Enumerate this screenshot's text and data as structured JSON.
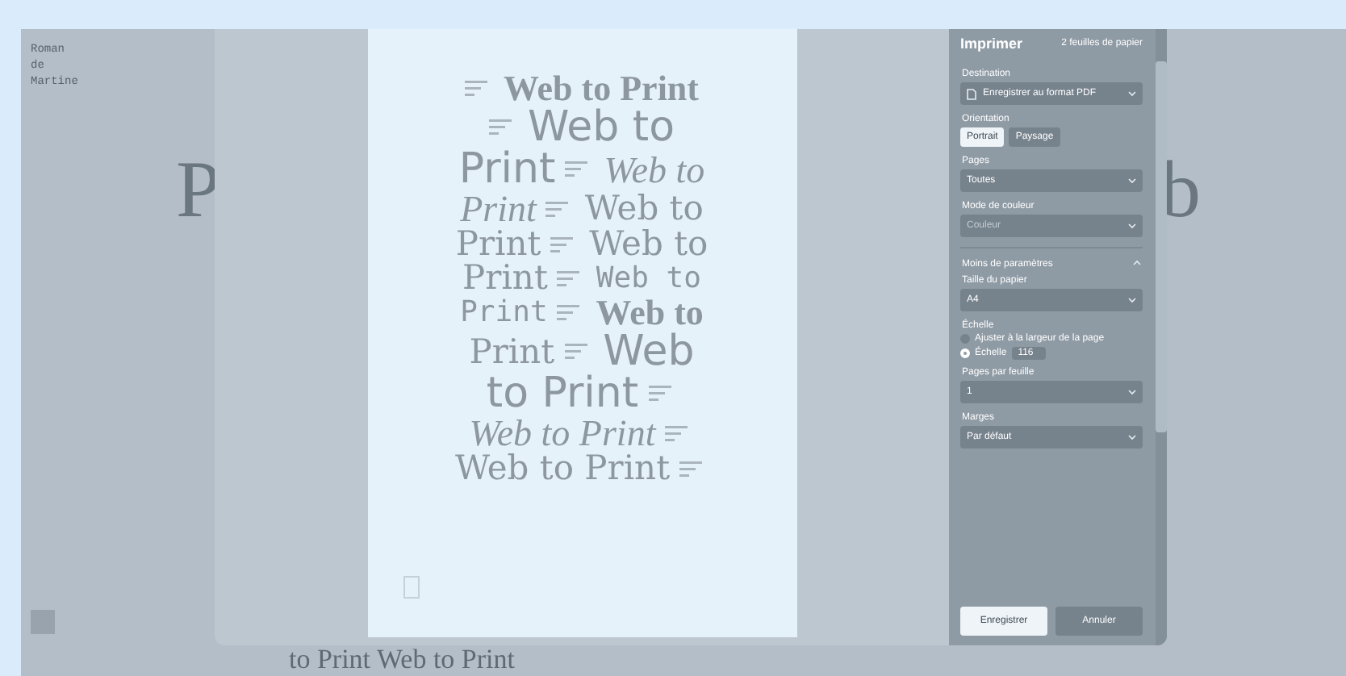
{
  "background_page": {
    "sidebar_text": [
      "Roman",
      "de",
      "Martine"
    ],
    "big_letters": [
      "P",
      "b"
    ],
    "bottom_text": "to Print Web to Print"
  },
  "preview": {
    "lines": [
      [
        {
          "kind": "caption"
        },
        {
          "kind": "serif-bold",
          "text": "Web to Print"
        }
      ],
      [
        {
          "kind": "caption"
        },
        {
          "kind": "sans",
          "text": "Web to"
        }
      ],
      [
        {
          "kind": "sans",
          "text": "Print"
        },
        {
          "kind": "caption"
        },
        {
          "kind": "serif-italic",
          "text": "Web to"
        }
      ],
      [
        {
          "kind": "serif-italic",
          "text": "Print"
        },
        {
          "kind": "caption"
        },
        {
          "kind": "serif",
          "text": "Web to"
        }
      ],
      [
        {
          "kind": "serif",
          "text": "Print"
        },
        {
          "kind": "caption"
        },
        {
          "kind": "serif",
          "text": "Web to"
        }
      ],
      [
        {
          "kind": "serif",
          "text": "Print"
        },
        {
          "kind": "caption"
        },
        {
          "kind": "mono",
          "text": "Web to"
        }
      ],
      [
        {
          "kind": "mono",
          "text": "Print"
        },
        {
          "kind": "caption"
        },
        {
          "kind": "serif-bold",
          "text": "Web to"
        }
      ],
      [
        {
          "kind": "serif",
          "text": "Print"
        },
        {
          "kind": "caption"
        },
        {
          "kind": "sans",
          "text": "Web"
        }
      ],
      [
        {
          "kind": "sans",
          "text": "to Print"
        },
        {
          "kind": "caption"
        }
      ],
      [
        {
          "kind": "serif-italic",
          "text": "Web to Print"
        },
        {
          "kind": "caption"
        }
      ],
      [
        {
          "kind": "serif",
          "text": "Web to Print"
        },
        {
          "kind": "caption"
        }
      ]
    ]
  },
  "print_panel": {
    "title": "Imprimer",
    "sheets": "2 feuilles de papier",
    "fields": [
      {
        "kind": "select",
        "label": "Destination",
        "value": "Enregistrer au format PDF",
        "disabled": false,
        "icon": true
      },
      {
        "kind": "toggle",
        "label": "Orientation",
        "options": [
          {
            "label": "Portrait",
            "selected": true
          },
          {
            "label": "Paysage",
            "selected": false
          }
        ]
      },
      {
        "kind": "select",
        "label": "Pages",
        "value": "Toutes",
        "disabled": false
      },
      {
        "kind": "select",
        "label": "Mode de couleur",
        "value": "Couleur",
        "disabled": true
      },
      {
        "kind": "expander",
        "label": "Moins de paramètres",
        "expanded": true
      },
      {
        "kind": "select",
        "label": "Taille du papier",
        "value": "A4",
        "disabled": false
      },
      {
        "kind": "radio",
        "label": "Échelle",
        "options": [
          {
            "label": "Ajuster à la largeur de la page",
            "selected": false
          },
          {
            "label": "Échelle",
            "selected": true,
            "value": "116"
          }
        ]
      },
      {
        "kind": "select",
        "label": "Pages par feuille",
        "value": "1",
        "disabled": false
      },
      {
        "kind": "select",
        "label": "Marges",
        "value": "Par défaut",
        "disabled": false
      }
    ],
    "buttons": [
      {
        "label": "Enregistrer",
        "primary": true
      },
      {
        "label": "Annuler",
        "primary": false
      }
    ]
  }
}
